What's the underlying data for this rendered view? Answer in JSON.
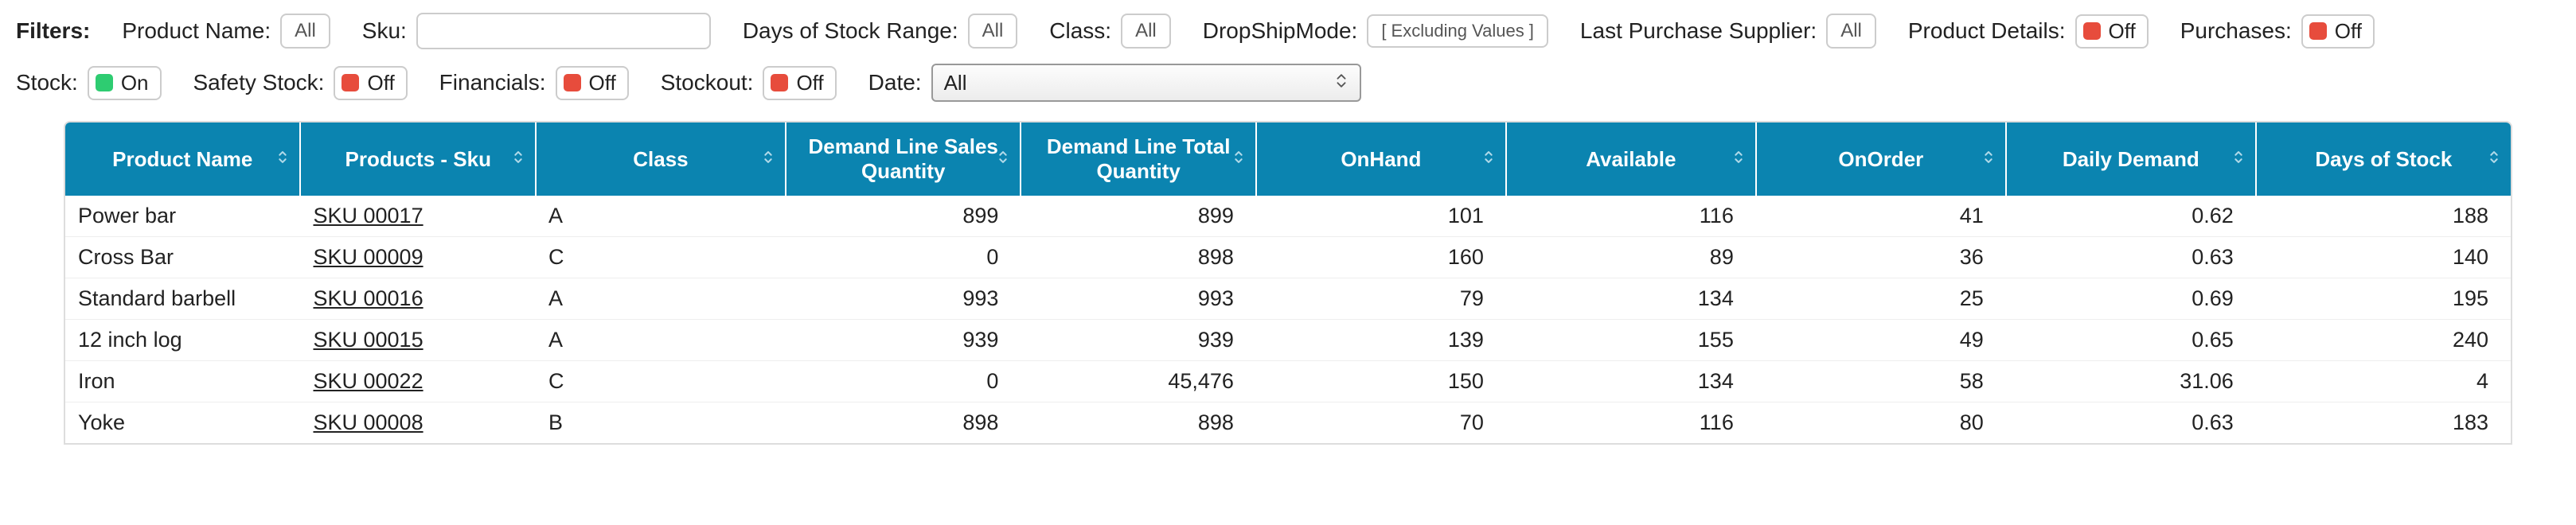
{
  "filters_label": "Filters:",
  "filters_row1": {
    "product_name": {
      "label": "Product Name:",
      "value": "All"
    },
    "sku": {
      "label": "Sku:",
      "value": ""
    },
    "days_range": {
      "label": "Days of Stock Range:",
      "value": "All"
    },
    "class": {
      "label": "Class:",
      "value": "All"
    },
    "dropship": {
      "label": "DropShipMode:",
      "value": "[ Excluding Values ]"
    },
    "last_supplier": {
      "label": "Last Purchase Supplier:",
      "value": "All"
    },
    "product_details": {
      "label": "Product Details:",
      "state": "Off",
      "color": "red"
    },
    "purchases": {
      "label": "Purchases:",
      "state": "Off",
      "color": "red"
    }
  },
  "filters_row2": {
    "stock": {
      "label": "Stock:",
      "state": "On",
      "color": "green"
    },
    "safety_stock": {
      "label": "Safety Stock:",
      "state": "Off",
      "color": "red"
    },
    "financials": {
      "label": "Financials:",
      "state": "Off",
      "color": "red"
    },
    "stockout": {
      "label": "Stockout:",
      "state": "Off",
      "color": "red"
    },
    "date": {
      "label": "Date:",
      "value": "All"
    }
  },
  "table": {
    "columns": [
      "Product Name",
      "Products - Sku",
      "Class",
      "Demand Line Sales Quantity",
      "Demand Line Total Quantity",
      "OnHand",
      "Available",
      "OnOrder",
      "Daily Demand",
      "Days of Stock"
    ],
    "rows": [
      {
        "name": "Power bar",
        "sku": "SKU 00017",
        "class": "A",
        "dsq": "899",
        "dtq": "899",
        "onhand": "101",
        "avail": "116",
        "onorder": "41",
        "dd": "0.62",
        "dos": "188"
      },
      {
        "name": "Cross Bar",
        "sku": "SKU 00009",
        "class": "C",
        "dsq": "0",
        "dtq": "898",
        "onhand": "160",
        "avail": "89",
        "onorder": "36",
        "dd": "0.63",
        "dos": "140"
      },
      {
        "name": "Standard barbell",
        "sku": "SKU 00016",
        "class": "A",
        "dsq": "993",
        "dtq": "993",
        "onhand": "79",
        "avail": "134",
        "onorder": "25",
        "dd": "0.69",
        "dos": "195"
      },
      {
        "name": "12 inch log",
        "sku": "SKU 00015",
        "class": "A",
        "dsq": "939",
        "dtq": "939",
        "onhand": "139",
        "avail": "155",
        "onorder": "49",
        "dd": "0.65",
        "dos": "240"
      },
      {
        "name": "Iron",
        "sku": "SKU 00022",
        "class": "C",
        "dsq": "0",
        "dtq": "45,476",
        "onhand": "150",
        "avail": "134",
        "onorder": "58",
        "dd": "31.06",
        "dos": "4"
      },
      {
        "name": "Yoke",
        "sku": "SKU 00008",
        "class": "B",
        "dsq": "898",
        "dtq": "898",
        "onhand": "70",
        "avail": "116",
        "onorder": "80",
        "dd": "0.63",
        "dos": "183"
      }
    ]
  },
  "chart_data": {
    "type": "table",
    "columns": [
      "Product Name",
      "Products - Sku",
      "Class",
      "Demand Line Sales Quantity",
      "Demand Line Total Quantity",
      "OnHand",
      "Available",
      "OnOrder",
      "Daily Demand",
      "Days of Stock"
    ],
    "rows": [
      [
        "Power bar",
        "SKU 00017",
        "A",
        899,
        899,
        101,
        116,
        41,
        0.62,
        188
      ],
      [
        "Cross Bar",
        "SKU 00009",
        "C",
        0,
        898,
        160,
        89,
        36,
        0.63,
        140
      ],
      [
        "Standard barbell",
        "SKU 00016",
        "A",
        993,
        993,
        79,
        134,
        25,
        0.69,
        195
      ],
      [
        "12 inch log",
        "SKU 00015",
        "A",
        939,
        939,
        139,
        155,
        49,
        0.65,
        240
      ],
      [
        "Iron",
        "SKU 00022",
        "C",
        0,
        45476,
        150,
        134,
        58,
        31.06,
        4
      ],
      [
        "Yoke",
        "SKU 00008",
        "B",
        898,
        898,
        70,
        116,
        80,
        0.63,
        183
      ]
    ]
  }
}
